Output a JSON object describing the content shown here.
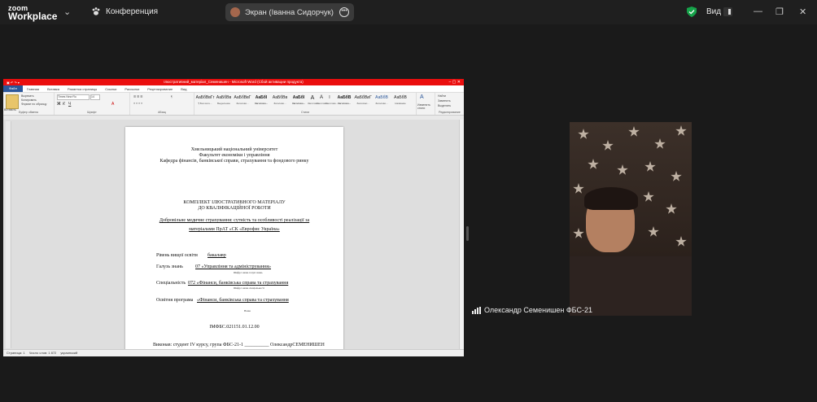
{
  "app": {
    "brand_line1": "zoom",
    "brand_line2": "Workplace",
    "meeting_label": "Конференция",
    "share_label": "Экран (Іванна Сидорчук)",
    "view_label": "Вид",
    "status_color": "#16a34a"
  },
  "word": {
    "title": "Ілюстративний_матеріал_Семенишен - Microsoft Word (Сбой активации продукта)",
    "quick_access": "",
    "tabs": [
      "Файл",
      "Главная",
      "Вставка",
      "Разметка страницы",
      "Ссылки",
      "Рассылки",
      "Рецензирование",
      "Вид"
    ],
    "clipboard": {
      "paste": "Вставить",
      "cut": "Вырезать",
      "copy": "Копировать",
      "format": "Формат по образцу",
      "label": "Буфер обмена"
    },
    "font": {
      "name": "Times New Ro",
      "size": "14",
      "label": "Шрифт"
    },
    "paragraph_label": "Абзац",
    "styles": [
      {
        "sample": "АаБбВвГг",
        "name": "¶ Без инте..."
      },
      {
        "sample": "АаБбВв",
        "name": "Выделение"
      },
      {
        "sample": "АаБбВвГ",
        "name": "Заголово..."
      },
      {
        "sample": "АаБбІ",
        "name": "Заголово..."
      },
      {
        "sample": "АаБбВв",
        "name": "Заголово..."
      },
      {
        "sample": "АаБбІ",
        "name": "Заголово..."
      },
      {
        "sample": "А",
        "name": "Заголово..."
      },
      {
        "sample": "А",
        "name": "Заголово..."
      },
      {
        "sample": "І",
        "name": "Заголово..."
      },
      {
        "sample": "АаБбВ",
        "name": "Заголово..."
      },
      {
        "sample": "АаБбВвГ",
        "name": "Заголово..."
      },
      {
        "sample": "АаБбВ",
        "name": "Заголово..."
      },
      {
        "sample": "АаБбВ",
        "name": "Название"
      }
    ],
    "styles_label": "Стили",
    "change_styles": "Изменить стили",
    "editing": {
      "find": "Найти",
      "replace": "Заменить",
      "select": "Выделить",
      "label": "Редактирование"
    },
    "status": {
      "page": "Страница: 1",
      "words": "Число слов: 1 872",
      "lang": "украинский"
    }
  },
  "doc": {
    "univ": "Хмельницький національний університет",
    "faculty": "Факультет економіки і управління",
    "dept": "Кафедра фінансів, банківської справи, страхування та фондового ринку",
    "kit1": "КОМПЛЕКТ ІЛЮСТРАТИВНОГО МАТЕРІАЛУ",
    "kit2": "ДО КВАЛІФІКАЦІЙНОЇ РОБОТИ",
    "topic1": "Добровільне медичне страхування: сутність та особливості реалізації за",
    "topic2": "матеріалами ПрАТ «СК «Еврофис Україна»",
    "level_label": "Рівень вищої освіти",
    "level_value": "бакалавр",
    "field_label": "Галузь знань",
    "field_value": "07 «Управління та адміністрування»",
    "field_note": "Шифр і назва галузі знань",
    "spec_label": "Спеціальність",
    "spec_value": "072 «Фінанси, банківська справа та страхування",
    "spec_note": "Шифр і назва спеціальності",
    "program_label": "Освітня програма",
    "program_value": "«Фінанси, банківська справа та страхування",
    "program_note": "Назва",
    "code": "ІМФБС.021151.01.12.00",
    "author": "Виконав: студент IV курсу, група ФБС-21-1 __________ ОлександрСЕМЕНИШЕН"
  },
  "participant": {
    "name": "Олександр Семенишен ФБС-21"
  }
}
